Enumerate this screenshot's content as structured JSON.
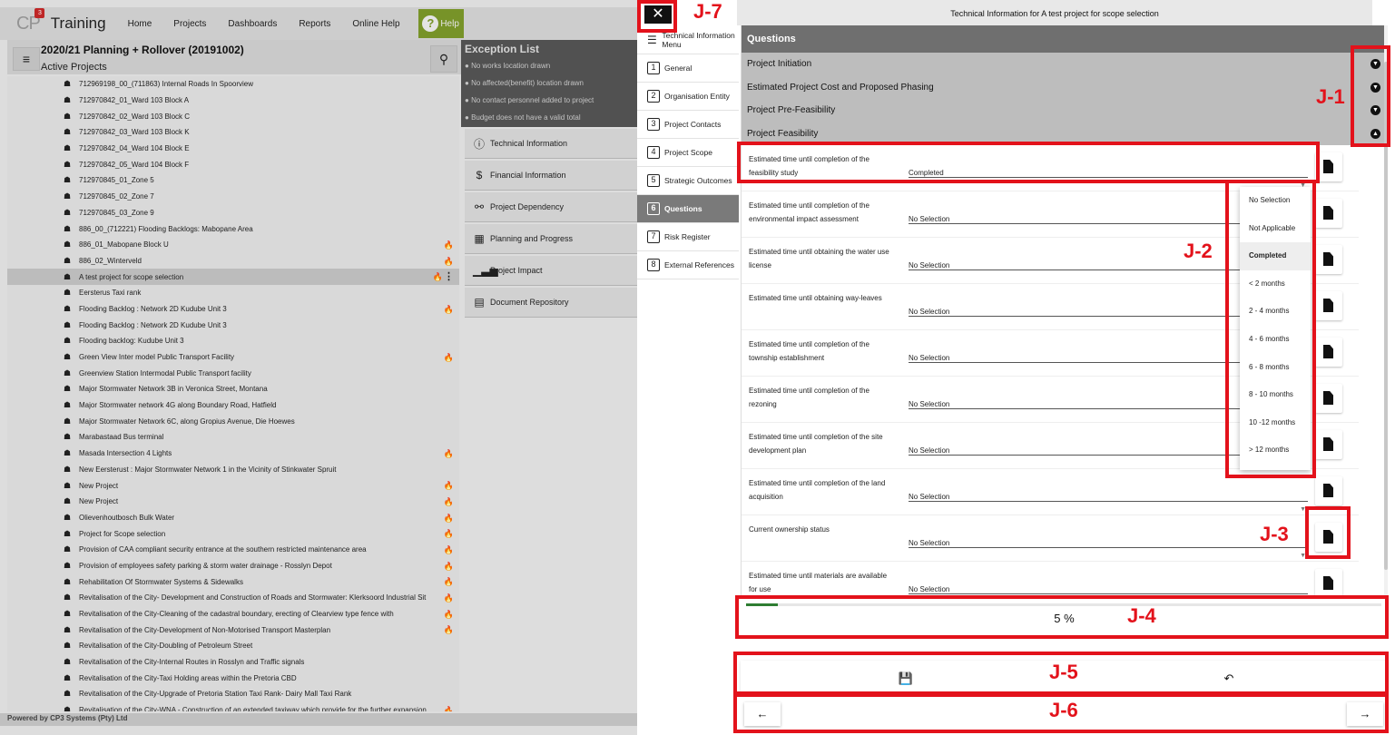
{
  "header": {
    "logo_text": "CP",
    "logo_badge": "3",
    "app_title": "Training",
    "nav": [
      "Home",
      "Projects",
      "Dashboards",
      "Reports",
      "Online Help"
    ],
    "help_label": "Help"
  },
  "project_header": {
    "title": "2020/21 Planning + Rollover (20191002)",
    "subtitle": "Active Projects"
  },
  "projects": [
    {
      "name": "712969198_00_(711863) Internal Roads In Spoorview",
      "flag": false
    },
    {
      "name": "712970842_01_Ward 103 Block A",
      "flag": false
    },
    {
      "name": "712970842_02_Ward 103 Block C",
      "flag": false
    },
    {
      "name": "712970842_03_Ward 103 Block K",
      "flag": false
    },
    {
      "name": "712970842_04_Ward 104 Block E",
      "flag": false
    },
    {
      "name": "712970842_05_Ward 104 Block F",
      "flag": false
    },
    {
      "name": "712970845_01_Zone 5",
      "flag": false
    },
    {
      "name": "712970845_02_Zone 7",
      "flag": false
    },
    {
      "name": "712970845_03_Zone 9",
      "flag": false
    },
    {
      "name": "886_00_(712221) Flooding Backlogs: Mabopane Area",
      "flag": false
    },
    {
      "name": "886_01_Mabopane Block U",
      "flag": true
    },
    {
      "name": "886_02_Winterveld",
      "flag": true
    },
    {
      "name": "A test project for scope selection",
      "flag": true,
      "selected": true
    },
    {
      "name": "Eersterus Taxi rank",
      "flag": false
    },
    {
      "name": "Flooding Backlog : Network 2D Kudube Unit 3",
      "flag": true
    },
    {
      "name": "Flooding Backlog : Network 2D Kudube Unit 3",
      "flag": false
    },
    {
      "name": "Flooding backlog: Kudube Unit 3",
      "flag": false
    },
    {
      "name": "Green View Inter model Public Transport Facility",
      "flag": true
    },
    {
      "name": "Greenview Station Intermodal Public Transport facility",
      "flag": false
    },
    {
      "name": "Major Stormwater Network 3B in Veronica Street, Montana",
      "flag": false
    },
    {
      "name": "Major Stormwater network 4G along Boundary Road, Hatfield",
      "flag": false
    },
    {
      "name": "Major Stormwater Network 6C, along Gropius Avenue, Die Hoewes",
      "flag": false
    },
    {
      "name": "Marabastaad Bus terminal",
      "flag": false
    },
    {
      "name": "Masada Intersection 4 Lights",
      "flag": true
    },
    {
      "name": "New Eersterust : Major Stormwater Network 1 in the Vicinity of Stinkwater Spruit",
      "flag": false
    },
    {
      "name": "New Project",
      "flag": true
    },
    {
      "name": "New Project",
      "flag": true
    },
    {
      "name": "Olievenhoutbosch Bulk Water",
      "flag": true
    },
    {
      "name": "Project for Scope selection",
      "flag": true
    },
    {
      "name": "Provision of CAA compliant security entrance at the southern restricted maintenance area",
      "flag": true
    },
    {
      "name": "Provision of employees safety parking & storm water drainage - Rosslyn Depot",
      "flag": true
    },
    {
      "name": "Rehabilitation Of Stormwater Systems & Sidewalks",
      "flag": true
    },
    {
      "name": "Revitalisation of the City- Development and Construction of Roads and Stormwater: Klerksoord Industrial Sit",
      "flag": true
    },
    {
      "name": "Revitalisation of the City-Cleaning of the cadastral boundary, erecting of Clearview type fence with",
      "flag": true
    },
    {
      "name": "Revitalisation of the City-Development of Non-Motorised Transport Masterplan",
      "flag": true
    },
    {
      "name": "Revitalisation of the City-Doubling of Petroleum Street",
      "flag": false
    },
    {
      "name": "Revitalisation of the City-Internal Routes in Rosslyn and Traffic signals",
      "flag": false
    },
    {
      "name": "Revitalisation of the City-Taxi Holding areas within the Pretoria CBD",
      "flag": false
    },
    {
      "name": "Revitalisation of the City-Upgrade of Pretoria Station Taxi Rank- Dairy Mall Taxi Rank",
      "flag": false
    },
    {
      "name": "Revitalisation of the City-WNA - Construction of an extended taxiway which provide for the further expansion",
      "flag": true
    }
  ],
  "footer": "Powered by CP3 Systems (Pty) Ltd",
  "exceptions": {
    "title": "Exception List",
    "items": [
      "No works location drawn",
      "No affected(benefit) location drawn",
      "No contact personnel added to project",
      "Budget does not have a valid total"
    ]
  },
  "ti_menu": [
    {
      "icon": "info-icon",
      "label": "Technical Information"
    },
    {
      "icon": "dollar-icon",
      "label": "Financial Information"
    },
    {
      "icon": "dependency-icon",
      "label": "Project Dependency"
    },
    {
      "icon": "calendar-icon",
      "label": "Planning and Progress"
    },
    {
      "icon": "chart-icon",
      "label": "Project Impact"
    },
    {
      "icon": "document-icon",
      "label": "Document Repository"
    }
  ],
  "modal": {
    "title": "Technical Information for A test project for scope selection",
    "side_menu_title": "Technical Information Menu",
    "side_menu": [
      {
        "num": "1",
        "label": "General"
      },
      {
        "num": "2",
        "label": "Organisation Entity"
      },
      {
        "num": "3",
        "label": "Project Contacts"
      },
      {
        "num": "4",
        "label": "Project Scope"
      },
      {
        "num": "5",
        "label": "Strategic Outcomes"
      },
      {
        "num": "6",
        "label": "Questions",
        "active": true
      },
      {
        "num": "7",
        "label": "Risk Register"
      },
      {
        "num": "8",
        "label": "External References"
      }
    ],
    "questions_title": "Questions",
    "sections": [
      {
        "label": "Project Initiation",
        "expanded": false
      },
      {
        "label": "Estimated Project Cost and Proposed Phasing",
        "expanded": false
      },
      {
        "label": "Project Pre-Feasibility",
        "expanded": false
      },
      {
        "label": "Project Feasibility",
        "expanded": true
      }
    ],
    "questions": [
      {
        "label": "Estimated time until completion of the feasibility study",
        "value": "Completed"
      },
      {
        "label": "Estimated time until completion of the environmental impact assessment",
        "value": "No Selection"
      },
      {
        "label": "Estimated time until obtaining the water use license",
        "value": "No Selection"
      },
      {
        "label": "Estimated time until obtaining way-leaves",
        "value": "No Selection"
      },
      {
        "label": "Estimated time until completion of the township establishment",
        "value": "No Selection"
      },
      {
        "label": "Estimated time until completion of the rezoning",
        "value": "No Selection"
      },
      {
        "label": "Estimated time until completion of the site development plan",
        "value": "No Selection"
      },
      {
        "label": "Estimated time until completion of the land acquisition",
        "value": "No Selection"
      },
      {
        "label": "Current ownership status",
        "value": "No Selection"
      },
      {
        "label": "Estimated time until materials are available for use",
        "value": "No Selection"
      }
    ],
    "dropdown_options": [
      "No Selection",
      "Not Applicable",
      "Completed",
      "< 2 months",
      "2 - 4 months",
      "4 - 6 months",
      "6 - 8 months",
      "8 - 10 months",
      "10 -12 months",
      "> 12 months"
    ],
    "dropdown_selected": "Completed",
    "progress_percent": 5,
    "progress_text": "5 %"
  },
  "annotations": {
    "j1": "J-1",
    "j2": "J-2",
    "j3": "J-3",
    "j4": "J-4",
    "j5": "J-5",
    "j6": "J-6",
    "j7": "J-7",
    "color": "#e3121b"
  }
}
